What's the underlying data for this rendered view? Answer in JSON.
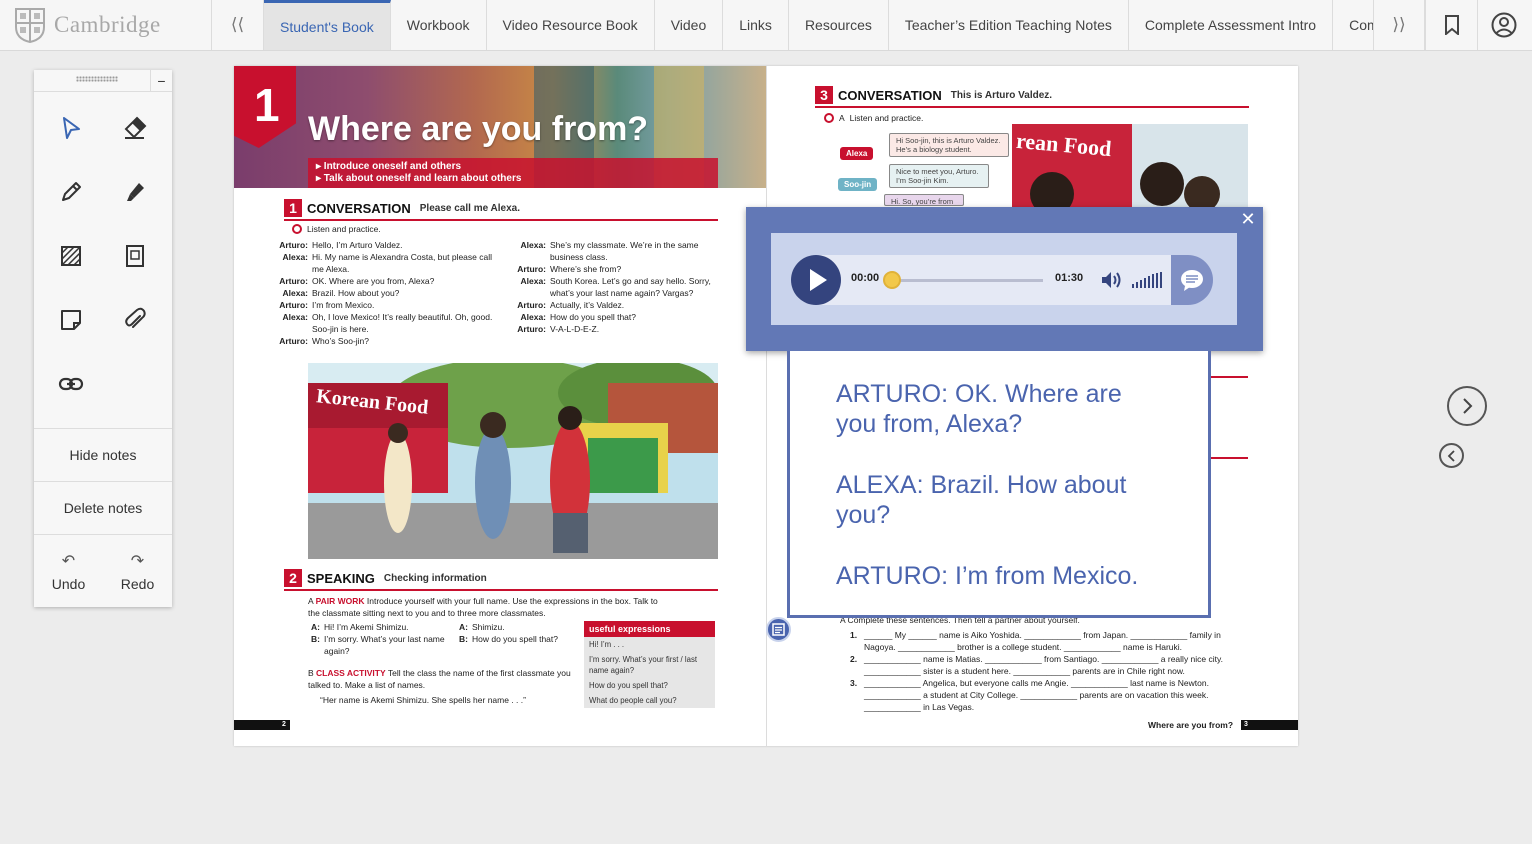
{
  "header": {
    "brand": "Cambridge",
    "left_arrow": "⟨⟨",
    "right_arrow": "⟩⟩",
    "tabs": [
      {
        "label": "Student's Book",
        "active": true
      },
      {
        "label": "Workbook"
      },
      {
        "label": "Video Resource Book"
      },
      {
        "label": "Video"
      },
      {
        "label": "Links"
      },
      {
        "label": "Resources"
      },
      {
        "label": "Teacher’s Edition Teaching Notes"
      },
      {
        "label": "Complete Assessment Intro"
      },
      {
        "label": "Complete"
      }
    ],
    "icons": [
      "bookmark-icon",
      "account-icon"
    ],
    "accent": "#3a66b3"
  },
  "toolbox": {
    "minimize": "−",
    "tools": [
      "select-pointer-icon",
      "eraser-icon",
      "pencil-icon",
      "highlighter-icon",
      "hatch-area-icon",
      "frame-icon",
      "sticky-note-icon",
      "attachment-icon",
      "link-icon"
    ],
    "hide_notes": "Hide notes",
    "delete_notes": "Delete notes",
    "undo": "Undo",
    "redo": "Redo",
    "undo_glyph": "↶",
    "redo_glyph": "↷"
  },
  "book": {
    "unit_number": "1",
    "unit_title": "Where are you from?",
    "objectives": [
      "▸ Introduce oneself and others",
      "▸ Talk about oneself and learn about others"
    ],
    "section1": {
      "number": "1",
      "title": "CONVERSATION",
      "subtitle": "Please call me Alexa.",
      "instruction": "Listen and practice.",
      "left": [
        {
          "speaker": "Arturo:",
          "line": "Hello, I’m Arturo Valdez."
        },
        {
          "speaker": "Alexa:",
          "line": "Hi. My name is Alexandra Costa, but please call me Alexa."
        },
        {
          "speaker": "Arturo:",
          "line": "OK. Where are you from, Alexa?"
        },
        {
          "speaker": "Alexa:",
          "line": "Brazil. How about you?"
        },
        {
          "speaker": "Arturo:",
          "line": "I’m from Mexico."
        },
        {
          "speaker": "Alexa:",
          "line": "Oh, I love Mexico! It’s really beautiful. Oh, good. Soo-jin is here."
        },
        {
          "speaker": "Arturo:",
          "line": "Who’s Soo-jin?"
        }
      ],
      "right": [
        {
          "speaker": "Alexa:",
          "line": "She’s my classmate. We’re in the same business class."
        },
        {
          "speaker": "Arturo:",
          "line": "Where’s she from?"
        },
        {
          "speaker": "Alexa:",
          "line": "South Korea. Let’s go and say hello. Sorry, what’s your last name again? Vargas?"
        },
        {
          "speaker": "Arturo:",
          "line": "Actually, it’s Valdez."
        },
        {
          "speaker": "Alexa:",
          "line": "How do you spell that?"
        },
        {
          "speaker": "Arturo:",
          "line": "V-A-L-D-E-Z."
        }
      ]
    },
    "scene_sign": "Korean Food",
    "section2": {
      "number": "2",
      "title": "SPEAKING",
      "subtitle": "Checking information",
      "a_label": "A",
      "a_key": "PAIR WORK",
      "a_text": "Introduce yourself with your full name. Use the expressions in the box. Talk to the classmate sitting next to you and to three more classmates.",
      "pairs": [
        {
          "speaker": "A:",
          "line": "Hi! I’m Akemi Shimizu."
        },
        {
          "speaker": "B:",
          "line": "I’m sorry. What’s your last name again?"
        },
        {
          "speaker": "A:",
          "line": "Shimizu."
        },
        {
          "speaker": "B:",
          "line": "How do you spell that?"
        }
      ],
      "b_label": "B",
      "b_key": "CLASS ACTIVITY",
      "b_text": "Tell the class the name of the first classmate you talked to. Make a list of names.",
      "quote": "“Her name is Akemi Shimizu. She spells her name . . .”"
    },
    "useful": {
      "title": "useful expressions",
      "items": [
        "Hi! I’m . . .",
        "I’m sorry. What’s your first / last name again?",
        "How do you spell that?",
        "What do people call you?"
      ]
    },
    "page_left": "2",
    "section3": {
      "number": "3",
      "title": "CONVERSATION",
      "subtitle": "This is Arturo Valdez.",
      "a_label": "A",
      "instruction": "Listen and practice.",
      "bubbles": [
        "Hi Soo-jin, this is Arturo Valdez. He’s a biology student.",
        "Nice to meet you, Arturo. I’m Soo-jin Kim.",
        "Hi. So, you’re from"
      ],
      "names": [
        "Alexa",
        "Soo-jin"
      ],
      "photo_sign": "rean Food"
    },
    "exercise": {
      "intro": "A  Complete these sentences. Then tell a partner about yourself.",
      "items": [
        {
          "num": "1.",
          "l1": "______ My ______ name is Aiko Yoshida. ____________ from Japan. ____________ family in",
          "l2": "Nagoya. ____________ brother is a college student. ____________ name is Haruki."
        },
        {
          "num": "2.",
          "l1": "____________ name is Matias. ____________ from Santiago. ____________ a really nice city.",
          "l2": "____________ sister is a student here. ____________ parents are in Chile right now."
        },
        {
          "num": "3.",
          "l1": "____________ Angelica, but everyone calls me Angie. ____________ last name is Newton.",
          "l2": "____________ a student at City College. ____________ parents are on vacation this week.",
          "l3": "____________ in Las Vegas."
        }
      ]
    },
    "footer_title": "Where are you from?",
    "page_right": "3"
  },
  "audio": {
    "close": "✕",
    "current_time": "00:00",
    "total_time": "01:30",
    "progress": 0
  },
  "transcript": {
    "lines": [
      "ARTURO: OK. Where are you from, Alexa?",
      "ALEXA: Brazil. How about you?",
      "ARTURO: I’m from Mexico."
    ],
    "color": "#4a64ae"
  }
}
